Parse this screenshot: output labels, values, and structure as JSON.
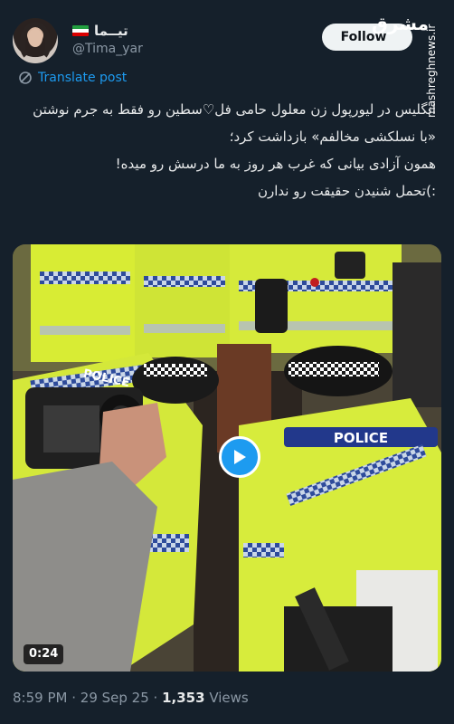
{
  "author": {
    "display_name": "تیــما",
    "handle": "@Tima_yar",
    "flag_colors": [
      "#239f40",
      "#ffffff",
      "#da0000"
    ]
  },
  "follow_label": "Follow",
  "watermark": {
    "logo": "مشرق",
    "vertical": "mashreghnews.ir"
  },
  "translate_label": "Translate post",
  "tweet_lines": [
    "انگلیس در لیورپول زن معلول حامی فل♡سطین رو فقط به جرم نوشتن «با نسلکشی مخالفم» بازداشت کرد؛",
    "همون آزادی بیانی که غرب هر روز به ما درسش رو میده!",
    ":)تحمل شنیدن حقیقت رو ندارن"
  ],
  "video": {
    "duration": "0:24",
    "police_label": "POLICE",
    "accent": "#1d9bf0"
  },
  "meta": {
    "time": "8:59 PM",
    "date": "29 Sep 25",
    "views_count": "1,353",
    "views_label": "Views"
  }
}
